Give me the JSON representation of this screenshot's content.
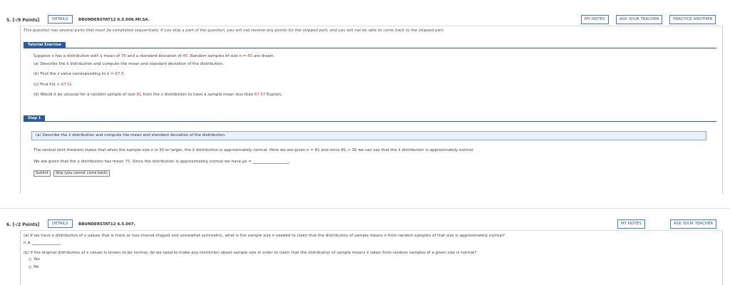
{
  "q5": {
    "number": "5.",
    "points": "[-/9 Points]",
    "details": "DETAILS",
    "code": "BBUNDERSTAT12 6.5.006.MI.SA.",
    "buttons": {
      "my_notes": "MY NOTES",
      "ask_teacher": "ASK YOUR TEACHER",
      "practice": "PRACTICE ANOTHER"
    },
    "warning": "This question has several parts that must be completed sequentially. If you skip a part of the question, you will not receive any points for the skipped part, and you will not be able to come back to the skipped part.",
    "tutorial_label": "Tutorial Exercise",
    "intro_a": "Suppose x has a distribution with a mean of ",
    "mean": "75",
    "intro_b": " and a standard deviation of ",
    "sd": "45",
    "intro_c": ". Random samples of size n = ",
    "n": "81",
    "intro_d": " are drawn.",
    "part_a": "(a) Describe the x̄ distribution and compute the mean and standard deviation of the distribution.",
    "part_b_pre": "(b) Find the z value corresponding to x̄ = ",
    "xbar": "67.5",
    "part_b_post": ".",
    "part_c_pre": "(c) Find P(x̄ < ",
    "part_c_post": ").",
    "part_d_pre": "(d) Would it be unusual for a random sample of size ",
    "part_d_mid": " from the x distribution to have a sample mean less than ",
    "part_d_post": "? Explain.",
    "step_label": "Step 1",
    "step_box": "(a) Describe the x̄ distribution and compute the mean and standard deviation of the distribution.",
    "clt_text": "The central limit theorem states that when the sample size n is 30 or larger, the x̄ distribution is approximately normal. Here we are given n = 81 and since 81 > 30 we can say that the x̄ distribution is approximately normal.",
    "mean_pre": "We are given that the x distribution has mean ",
    "mean_post": ". Since the distribution is approximately normal we have μx̄ =",
    "mean_end": ".",
    "submit": "Submit",
    "skip": "Skip (you cannot come back)"
  },
  "q6": {
    "number": "6.",
    "points": "[-/2 Points]",
    "details": "DETAILS",
    "code": "BBUNDERSTAT12 6.5.007.",
    "buttons": {
      "my_notes": "MY NOTES",
      "ask_teacher": "ASK YOUR TEACHER"
    },
    "part_a": "(a) If we have a distribution of x values that is more or less mound-shaped and somewhat symmetric, what is the sample size n needed to claim that the distribution of sample means x̄ from random samples of that size is approximately normal?",
    "n_prompt": "n ≥",
    "part_b": "(b) If the original distribution of x values is known to be normal, do we need to make any restriction about sample size in order to claim that the distribution of sample means x̄ taken from random samples of a given size is normal?",
    "options": [
      "Yes",
      "No"
    ]
  }
}
